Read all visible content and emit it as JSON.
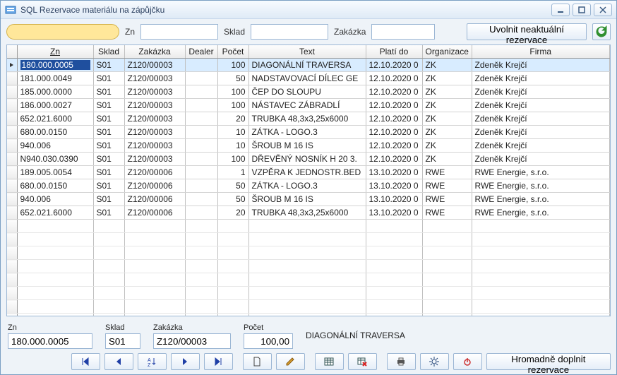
{
  "window": {
    "title": "SQL Rezervace materiálu na zápůjčku"
  },
  "filter": {
    "search_placeholder": "",
    "zn_label": "Zn",
    "sklad_label": "Sklad",
    "zakazka_label": "Zakázka",
    "release_btn": "Uvolnit neaktuální rezervace"
  },
  "columns": {
    "zn": "Zn",
    "sklad": "Sklad",
    "zakazka": "Zakázka",
    "dealer": "Dealer",
    "pocet": "Počet",
    "text": "Text",
    "plati": "Platí do",
    "org": "Organizace",
    "firma": "Firma"
  },
  "rows": [
    {
      "zn": "180.000.0005",
      "sklad": "S01",
      "zakazka": "Z120/00003",
      "dealer": "",
      "pocet": "100",
      "text": "DIAGONÁLNÍ TRAVERSA",
      "plati": "12.10.2020 0",
      "org": "ZK",
      "firma": "Zdeněk Krejčí"
    },
    {
      "zn": "181.000.0049",
      "sklad": "S01",
      "zakazka": "Z120/00003",
      "dealer": "",
      "pocet": "50",
      "text": "NADSTAVOVACÍ DÍLEC GE",
      "plati": "12.10.2020 0",
      "org": "ZK",
      "firma": "Zdeněk Krejčí"
    },
    {
      "zn": "185.000.0000",
      "sklad": "S01",
      "zakazka": "Z120/00003",
      "dealer": "",
      "pocet": "100",
      "text": "ČEP DO SLOUPU",
      "plati": "12.10.2020 0",
      "org": "ZK",
      "firma": "Zdeněk Krejčí"
    },
    {
      "zn": "186.000.0027",
      "sklad": "S01",
      "zakazka": "Z120/00003",
      "dealer": "",
      "pocet": "100",
      "text": "NÁSTAVEC ZÁBRADLÍ",
      "plati": "12.10.2020 0",
      "org": "ZK",
      "firma": "Zdeněk Krejčí"
    },
    {
      "zn": "652.021.6000",
      "sklad": "S01",
      "zakazka": "Z120/00003",
      "dealer": "",
      "pocet": "20",
      "text": "TRUBKA 48,3x3,25x6000",
      "plati": "12.10.2020 0",
      "org": "ZK",
      "firma": "Zdeněk Krejčí"
    },
    {
      "zn": "680.00.0150",
      "sklad": "S01",
      "zakazka": "Z120/00003",
      "dealer": "",
      "pocet": "10",
      "text": "ZÁTKA - LOGO.3",
      "plati": "12.10.2020 0",
      "org": "ZK",
      "firma": "Zdeněk Krejčí"
    },
    {
      "zn": "940.006",
      "sklad": "S01",
      "zakazka": "Z120/00003",
      "dealer": "",
      "pocet": "10",
      "text": "ŠROUB M 16 IS",
      "plati": "12.10.2020 0",
      "org": "ZK",
      "firma": "Zdeněk Krejčí"
    },
    {
      "zn": "N940.030.0390",
      "sklad": "S01",
      "zakazka": "Z120/00003",
      "dealer": "",
      "pocet": "100",
      "text": "DŘEVĚNÝ NOSNÍK H 20 3.",
      "plati": "12.10.2020 0",
      "org": "ZK",
      "firma": "Zdeněk Krejčí"
    },
    {
      "zn": "189.005.0054",
      "sklad": "S01",
      "zakazka": "Z120/00006",
      "dealer": "",
      "pocet": "1",
      "text": "VZPĚRA K JEDNOSTR.BED",
      "plati": "13.10.2020 0",
      "org": "RWE",
      "firma": "RWE Energie, s.r.o."
    },
    {
      "zn": "680.00.0150",
      "sklad": "S01",
      "zakazka": "Z120/00006",
      "dealer": "",
      "pocet": "50",
      "text": "ZÁTKA - LOGO.3",
      "plati": "13.10.2020 0",
      "org": "RWE",
      "firma": "RWE Energie, s.r.o."
    },
    {
      "zn": "940.006",
      "sklad": "S01",
      "zakazka": "Z120/00006",
      "dealer": "",
      "pocet": "50",
      "text": "ŠROUB M 16 IS",
      "plati": "13.10.2020 0",
      "org": "RWE",
      "firma": "RWE Energie, s.r.o."
    },
    {
      "zn": "652.021.6000",
      "sklad": "S01",
      "zakazka": "Z120/00006",
      "dealer": "",
      "pocet": "20",
      "text": "TRUBKA 48,3x3,25x6000",
      "plati": "13.10.2020 0",
      "org": "RWE",
      "firma": "RWE Energie, s.r.o."
    }
  ],
  "detail": {
    "zn_label": "Zn",
    "zn": "180.000.0005",
    "sklad_label": "Sklad",
    "sklad": "S01",
    "zakazka_label": "Zakázka",
    "zakazka": "Z120/00003",
    "pocet_label": "Počet",
    "pocet": "100,00",
    "text": "DIAGONÁLNÍ TRAVERSA"
  },
  "footer": {
    "bulk_btn": "Hromadně doplnit rezervace"
  }
}
